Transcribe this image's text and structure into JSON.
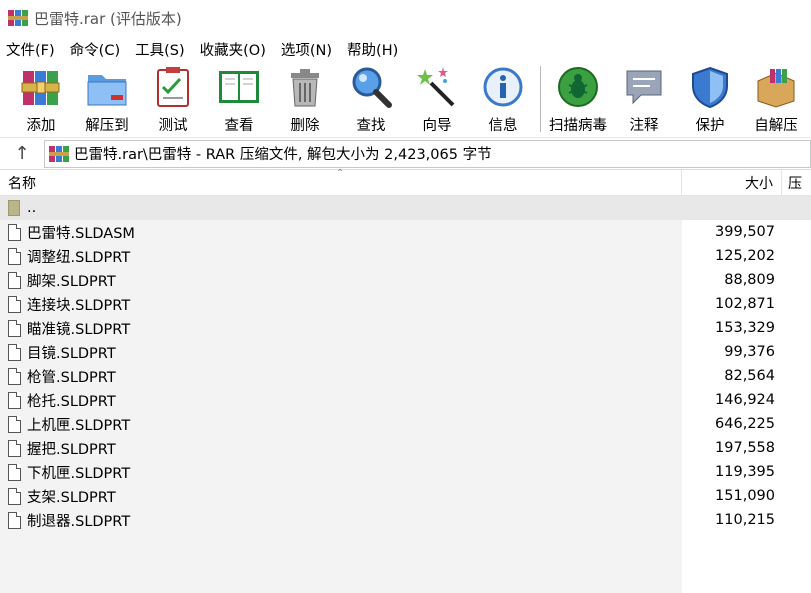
{
  "window": {
    "title": "巴雷特.rar (评估版本)"
  },
  "menu": [
    "文件(F)",
    "命令(C)",
    "工具(S)",
    "收藏夹(O)",
    "选项(N)",
    "帮助(H)"
  ],
  "toolbar": [
    {
      "label": "添加",
      "icon": "add-archive-icon"
    },
    {
      "label": "解压到",
      "icon": "extract-folder-icon"
    },
    {
      "label": "测试",
      "icon": "test-clipboard-icon"
    },
    {
      "label": "查看",
      "icon": "view-book-icon"
    },
    {
      "label": "删除",
      "icon": "trash-icon"
    },
    {
      "label": "查找",
      "icon": "magnifier-icon"
    },
    {
      "label": "向导",
      "icon": "wizard-wand-icon"
    },
    {
      "label": "信息",
      "icon": "info-icon"
    },
    {
      "label": "扫描病毒",
      "icon": "virus-scan-icon"
    },
    {
      "label": "注释",
      "icon": "comment-icon"
    },
    {
      "label": "保护",
      "icon": "shield-icon"
    },
    {
      "label": "自解压",
      "icon": "sfx-box-icon"
    }
  ],
  "address": {
    "text": "巴雷特.rar\\巴雷特 - RAR 压缩文件, 解包大小为 2,423,065 字节"
  },
  "columns": {
    "name": "名称",
    "size": "大小",
    "compressed": "压"
  },
  "parent_row": {
    "name": ".."
  },
  "files": [
    {
      "name": "巴雷特.SLDASM",
      "size": "399,507"
    },
    {
      "name": "调整纽.SLDPRT",
      "size": "125,202"
    },
    {
      "name": "脚架.SLDPRT",
      "size": "88,809"
    },
    {
      "name": "连接块.SLDPRT",
      "size": "102,871"
    },
    {
      "name": "瞄准镜.SLDPRT",
      "size": "153,329"
    },
    {
      "name": "目镜.SLDPRT",
      "size": "99,376"
    },
    {
      "name": "枪管.SLDPRT",
      "size": "82,564"
    },
    {
      "name": "枪托.SLDPRT",
      "size": "146,924"
    },
    {
      "name": "上机匣.SLDPRT",
      "size": "646,225"
    },
    {
      "name": "握把.SLDPRT",
      "size": "197,558"
    },
    {
      "name": "下机匣.SLDPRT",
      "size": "119,395"
    },
    {
      "name": "支架.SLDPRT",
      "size": "151,090"
    },
    {
      "name": "制退器.SLDPRT",
      "size": "110,215"
    }
  ]
}
